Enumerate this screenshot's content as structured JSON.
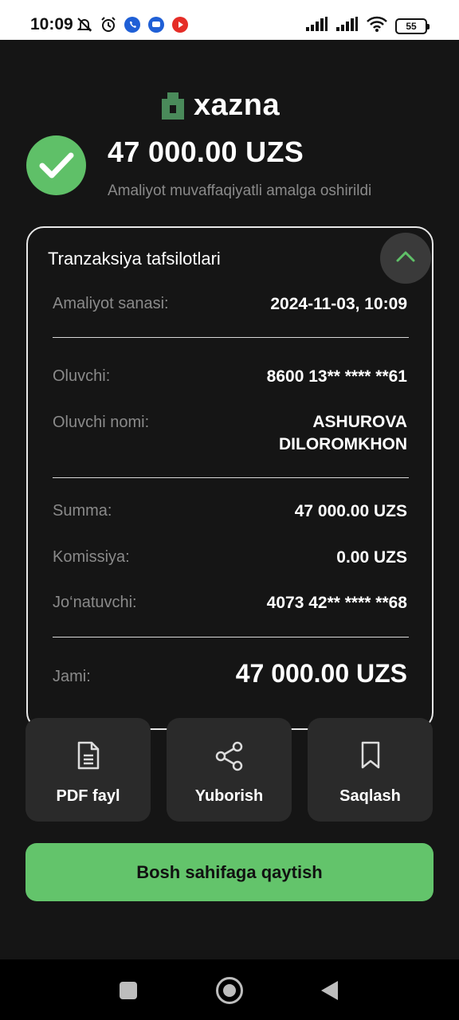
{
  "status_bar": {
    "time": "10:09",
    "battery": "55",
    "left_icons": [
      "muted-bell-icon",
      "alarm-icon",
      "phone-app-icon",
      "chat-app-icon",
      "youtube-icon"
    ],
    "right_icons": [
      "signal-icon",
      "signal-icon",
      "wifi-icon",
      "battery-icon"
    ]
  },
  "logo": {
    "text": "xazna",
    "brand_color": "#4a8a5a"
  },
  "success": {
    "amount": "47 000.00 UZS",
    "message": "Amaliyot muvaffaqiyatli amalga oshirildi",
    "icon": "check-icon",
    "color": "#5fc068"
  },
  "details": {
    "title": "Tranzaksiya tafsilotlari",
    "date_label": "Amaliyot sanasi:",
    "date_value": "2024-11-03, 10:09",
    "recipient_label": "Oluvchi:",
    "recipient_value": "8600 13** **** **61",
    "recipient_name_label": "Oluvchi nomi:",
    "recipient_name_line1": "ASHUROVA",
    "recipient_name_line2": "DILOROMKHON",
    "sum_label": "Summa:",
    "sum_value": "47 000.00 UZS",
    "fee_label": "Komissiya:",
    "fee_value": "0.00 UZS",
    "sender_label": "Jo‘natuvchi:",
    "sender_value": "4073 42** **** **68",
    "total_label": "Jami:",
    "total_value": "47 000.00 UZS"
  },
  "actions": {
    "pdf": "PDF fayl",
    "share": "Yuborish",
    "save": "Saqlash"
  },
  "home_button": "Bosh sahifaga qaytish",
  "accent_color": "#63c46b"
}
